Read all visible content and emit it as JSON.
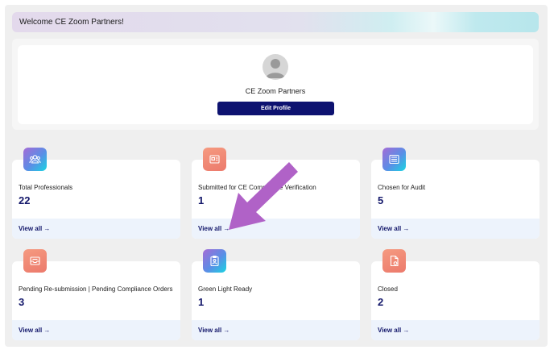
{
  "welcome": {
    "text": "Welcome CE Zoom Partners!"
  },
  "profile": {
    "name": "CE Zoom Partners",
    "edit_label": "Edit Profile"
  },
  "cards": [
    {
      "title": "Total Professionals",
      "count": "22",
      "link": "View all →",
      "icon": "people-icon",
      "badge": "purple"
    },
    {
      "title": "Submitted for CE Compliance Verification",
      "count": "1",
      "link": "View all →",
      "icon": "document-icon",
      "badge": "orange"
    },
    {
      "title": "Chosen for Audit",
      "count": "5",
      "link": "View all →",
      "icon": "list-icon",
      "badge": "purple"
    },
    {
      "title": "Pending Re-submission | Pending Compliance Orders",
      "count": "3",
      "link": "View all →",
      "icon": "inbox-icon",
      "badge": "orange"
    },
    {
      "title": "Green Light Ready",
      "count": "1",
      "link": "View all →",
      "icon": "clipboard-icon",
      "badge": "purple"
    },
    {
      "title": "Closed",
      "count": "2",
      "link": "View all →",
      "icon": "file-icon",
      "badge": "orange"
    }
  ],
  "annotation": {
    "icon": "arrow-annotation-icon",
    "color": "#b062c7"
  }
}
